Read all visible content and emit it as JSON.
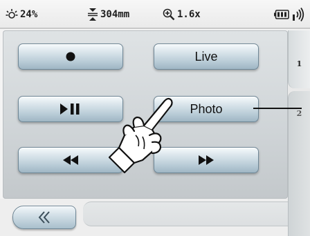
{
  "status": {
    "brightness": "24%",
    "depth": "304mm",
    "zoom": "1.6x",
    "battery_icon": "battery-icon",
    "signal_icon": "wireless-signal-icon"
  },
  "buttons": {
    "record": {
      "icon": "record-dot-icon"
    },
    "live": {
      "label": "Live"
    },
    "play_pause": {
      "icon": "play-pause-icon"
    },
    "photo": {
      "label": "Photo"
    },
    "rewind": {
      "icon": "rewind-icon"
    },
    "fast_forward": {
      "icon": "fast-forward-icon"
    },
    "back": {
      "icon": "double-chevron-left-icon"
    }
  },
  "tabs": [
    {
      "label": "1"
    },
    {
      "label": "2"
    }
  ],
  "colors": {
    "button_top": "#f6fafc",
    "button_bottom": "#9fb6c4",
    "panel": "#d3d7da",
    "text": "#111111"
  }
}
